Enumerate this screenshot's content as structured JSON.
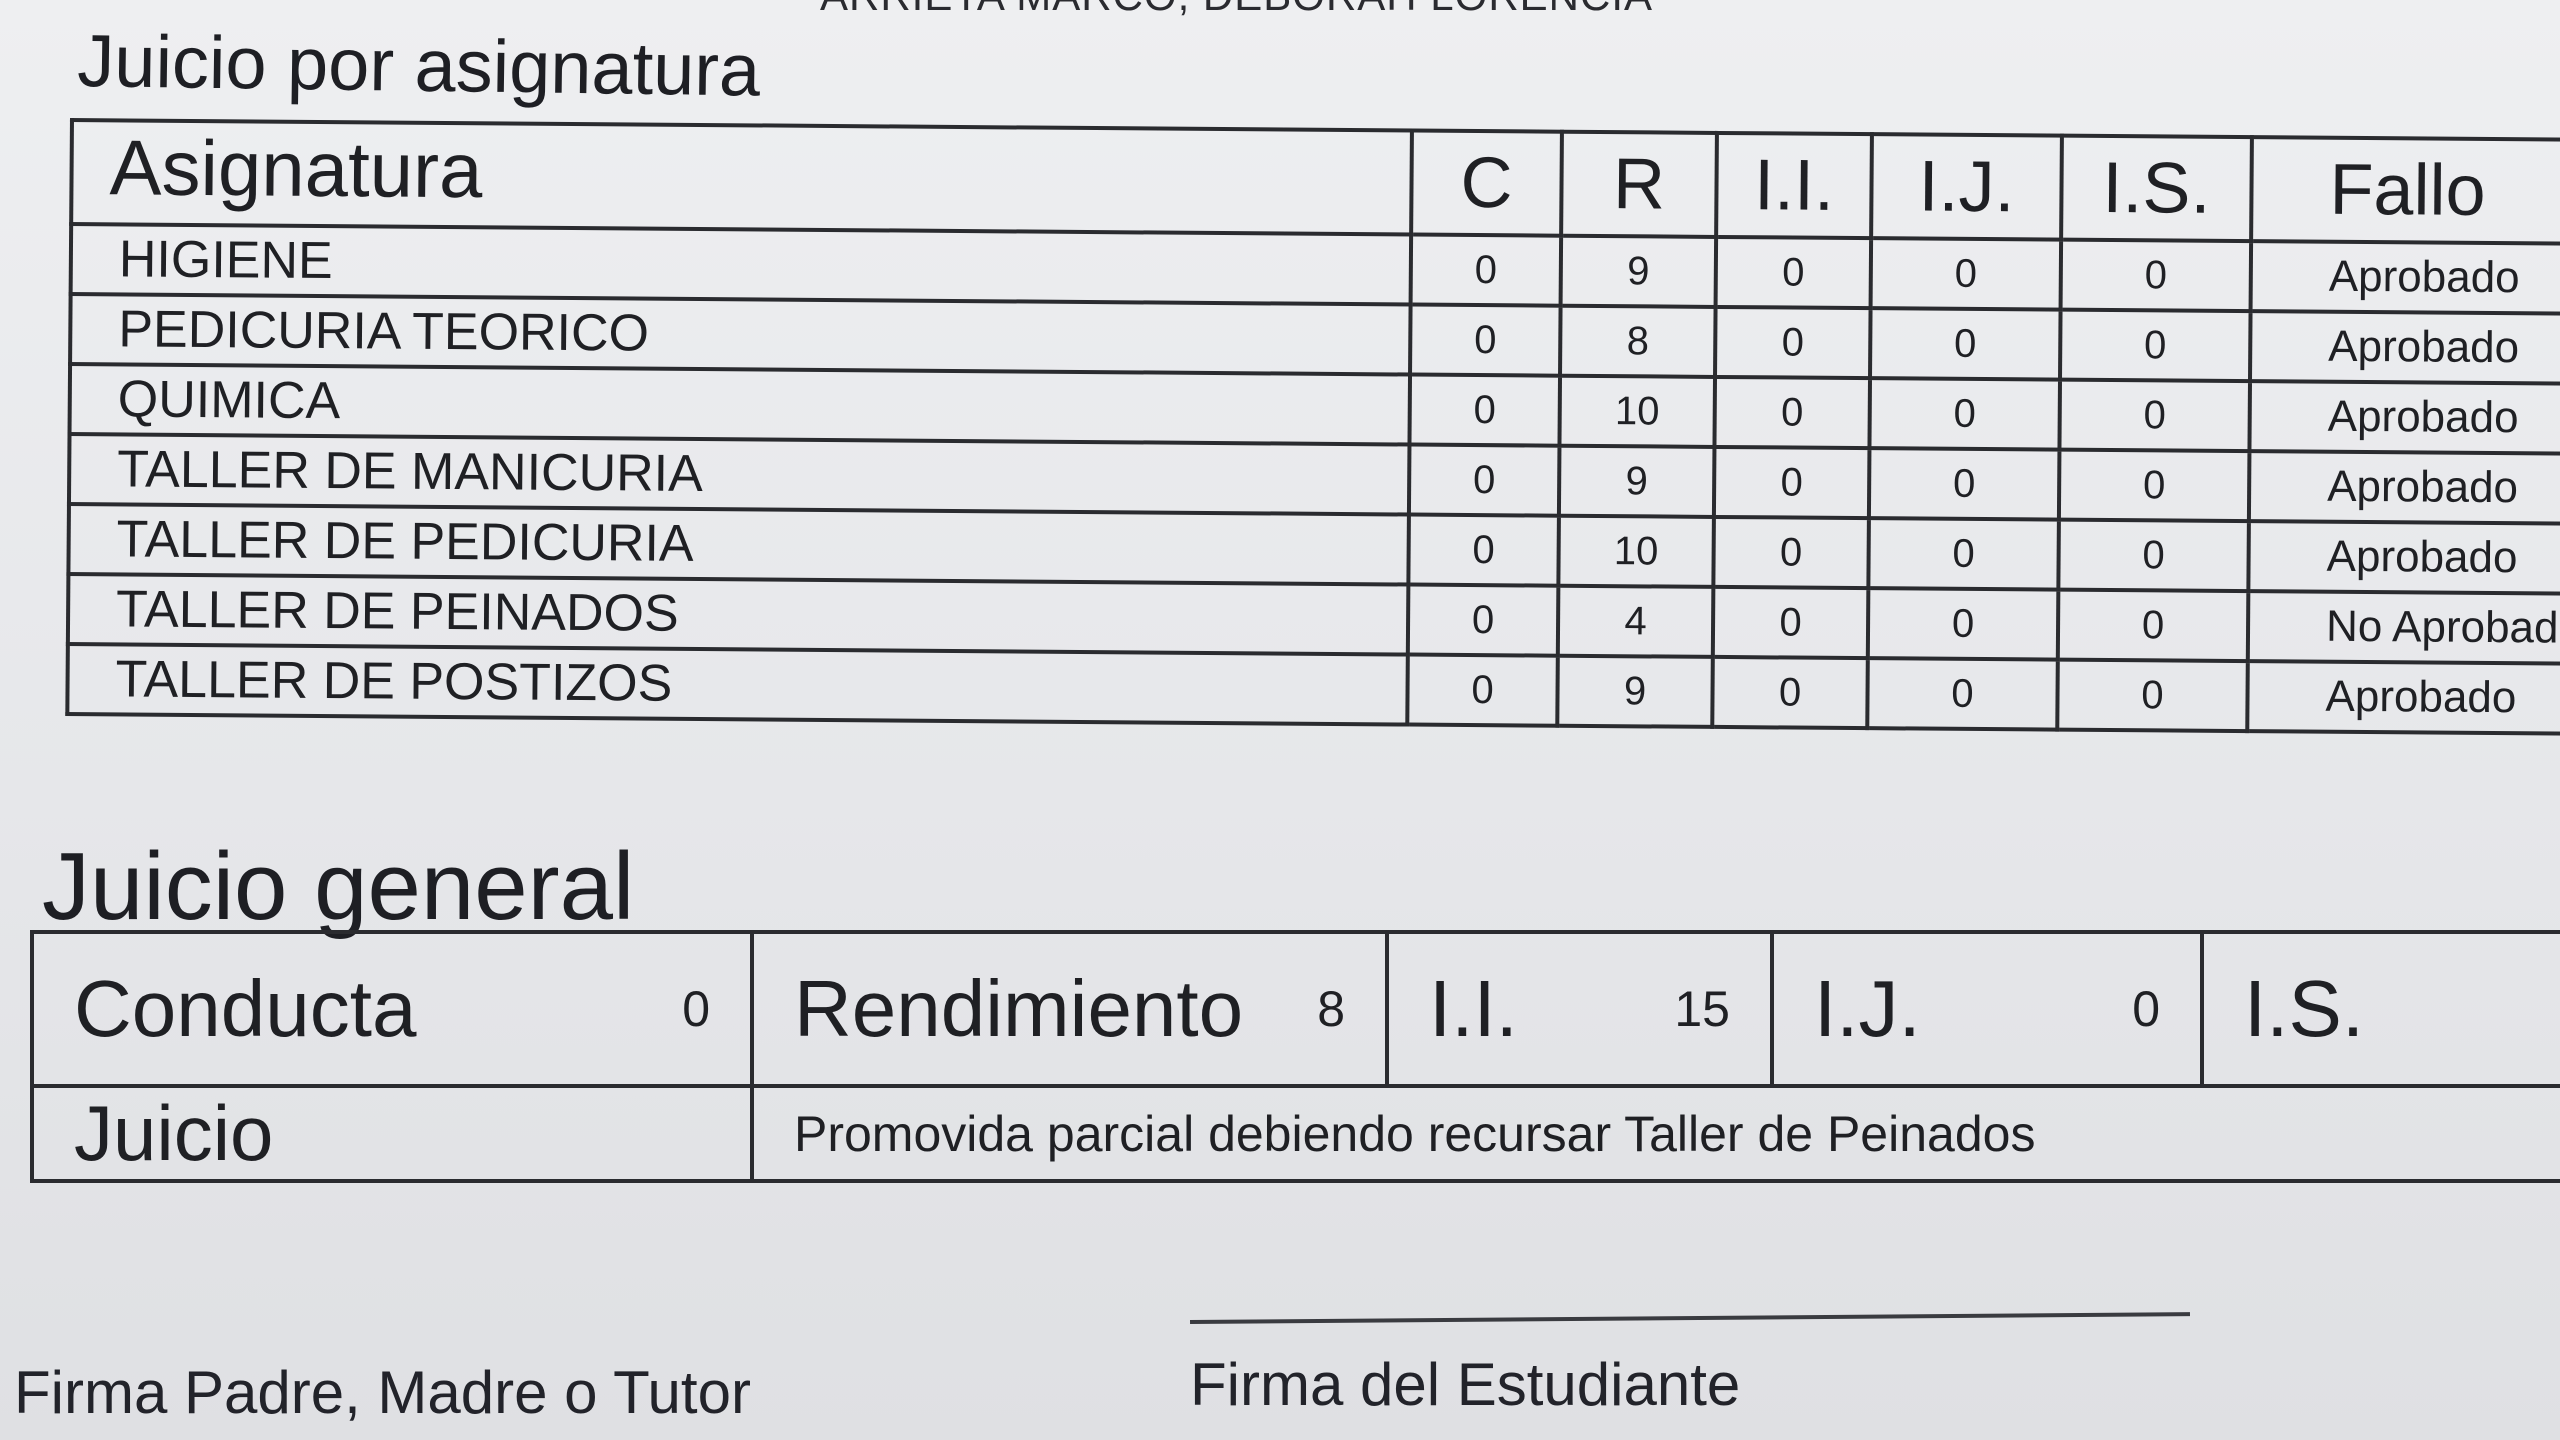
{
  "header": {
    "student_name_cut": "ARRIETA MARCO, DEBORAH LORENCIA",
    "subjects_title": "Juicio por asignatura"
  },
  "subjects_table": {
    "columns": [
      "Asignatura",
      "C",
      "R",
      "I.I.",
      "I.J.",
      "I.S.",
      "Fallo"
    ],
    "rows": [
      {
        "subject": "HIGIENE",
        "c": "0",
        "r": "9",
        "ii": "0",
        "ij": "0",
        "is": "0",
        "fallo": "Aprobado"
      },
      {
        "subject": "PEDICURIA TEORICO",
        "c": "0",
        "r": "8",
        "ii": "0",
        "ij": "0",
        "is": "0",
        "fallo": "Aprobado"
      },
      {
        "subject": "QUIMICA",
        "c": "0",
        "r": "10",
        "ii": "0",
        "ij": "0",
        "is": "0",
        "fallo": "Aprobado"
      },
      {
        "subject": "TALLER DE MANICURIA",
        "c": "0",
        "r": "9",
        "ii": "0",
        "ij": "0",
        "is": "0",
        "fallo": "Aprobado"
      },
      {
        "subject": "TALLER DE PEDICURIA",
        "c": "0",
        "r": "10",
        "ii": "0",
        "ij": "0",
        "is": "0",
        "fallo": "Aprobado"
      },
      {
        "subject": "TALLER DE PEINADOS",
        "c": "0",
        "r": "4",
        "ii": "0",
        "ij": "0",
        "is": "0",
        "fallo": "No Aprobado"
      },
      {
        "subject": "TALLER DE POSTIZOS",
        "c": "0",
        "r": "9",
        "ii": "0",
        "ij": "0",
        "is": "0",
        "fallo": "Aprobado"
      }
    ]
  },
  "general": {
    "title": "Juicio general",
    "conducta_label": "Conducta",
    "conducta_value": "0",
    "rendimiento_label": "Rendimiento",
    "rendimiento_value": "8",
    "ii_label": "I.I.",
    "ii_value": "15",
    "ij_label": "I.J.",
    "ij_value": "0",
    "is_label": "I.S.",
    "juicio_label": "Juicio",
    "juicio_text": "Promovida parcial debiendo recursar Taller de Peinados"
  },
  "signatures": {
    "parent": "Firma Padre, Madre o Tutor",
    "student": "Firma del Estudiante"
  }
}
